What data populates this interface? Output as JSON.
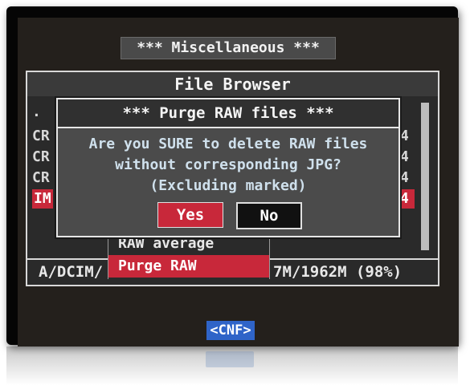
{
  "screen": {
    "title": "*** Miscellaneous ***",
    "cnf_label": "<CNF>"
  },
  "file_browser": {
    "title": "File Browser",
    "rows": [
      {
        "left": ".",
        "right": ""
      },
      {
        "left": "CR",
        "right": "4"
      },
      {
        "left": "CR",
        "right": "4"
      },
      {
        "left": "CR",
        "right": "4"
      },
      {
        "left": "IM",
        "right": "4"
      }
    ],
    "status_path": "A/DCIM/",
    "status_space": "7M/1962M (98%)"
  },
  "menu": {
    "items": [
      {
        "label": "RAW average",
        "selected": false
      },
      {
        "label": "Purge RAW",
        "selected": true
      }
    ]
  },
  "dialog": {
    "title": "*** Purge RAW files ***",
    "line1": "Are you SURE to delete RAW files",
    "line2": "without corresponding JPG?",
    "line3": "(Excluding marked)",
    "yes_label": "Yes",
    "no_label": "No"
  },
  "colors": {
    "highlight": "#c8283a",
    "cnf": "#2f64c8"
  }
}
